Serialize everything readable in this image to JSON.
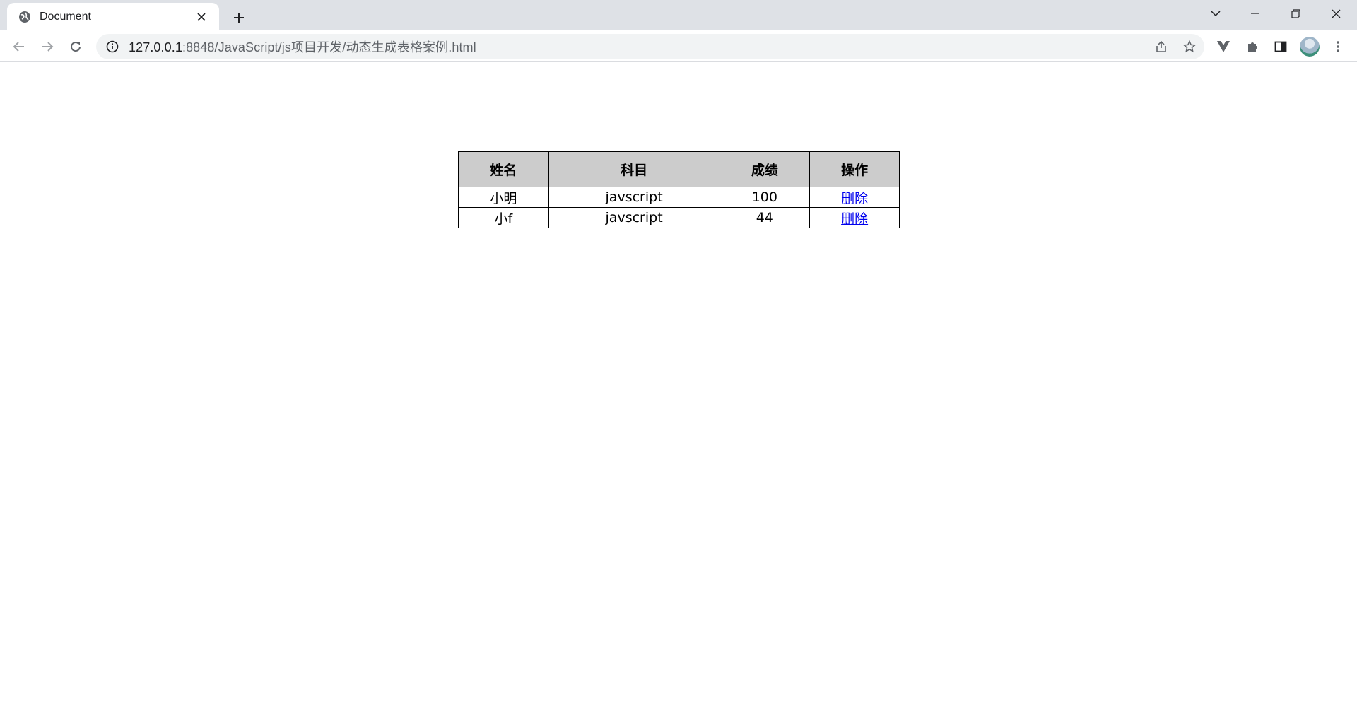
{
  "browser": {
    "tab": {
      "title": "Document",
      "close_icon": "close-icon"
    },
    "new_tab_label": "+",
    "address_bar": {
      "host": "127.0.0.1",
      "path": ":8848/JavaScript/js项目开发/动态生成表格案例.html"
    }
  },
  "page": {
    "table": {
      "headers": [
        "姓名",
        "科目",
        "成绩",
        "操作"
      ],
      "rows": [
        {
          "name": "小明",
          "subject": "javscript",
          "score": "100",
          "action": "删除"
        },
        {
          "name": "小f",
          "subject": "javscript",
          "score": "44",
          "action": "删除"
        }
      ]
    }
  },
  "colors": {
    "header_bg": "#cccccc",
    "link": "#0000ee",
    "tabstrip_bg": "#dee1e6",
    "omnibox_bg": "#f1f3f4"
  }
}
